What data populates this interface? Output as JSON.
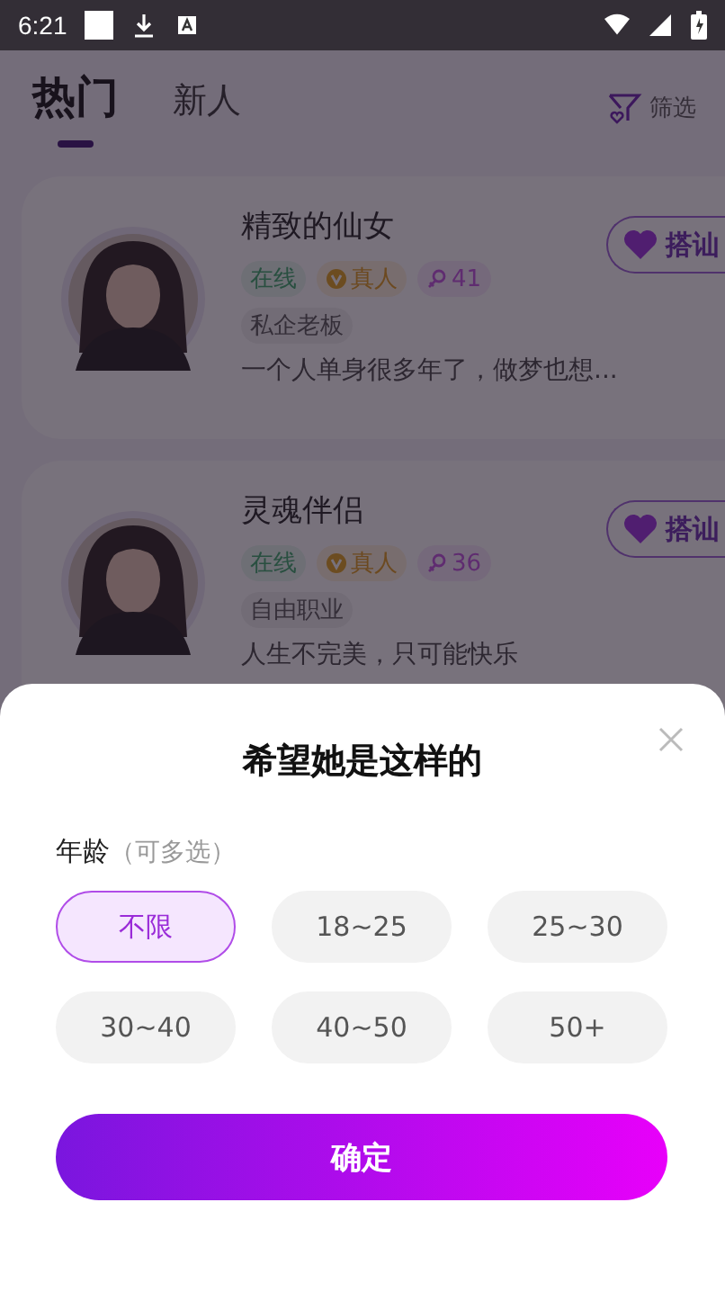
{
  "status_bar": {
    "time": "6:21"
  },
  "tabs": [
    {
      "label": "热门",
      "selected": true
    },
    {
      "label": "新人",
      "selected": false
    }
  ],
  "filter_label": "筛选",
  "cards": [
    {
      "name": "精致的仙女",
      "online": "在线",
      "verified": "真人",
      "age": "41",
      "job": "私企老板",
      "bio": "一个人单身很多年了，做梦也想...",
      "action": "搭讪"
    },
    {
      "name": "灵魂伴侣",
      "online": "在线",
      "verified": "真人",
      "age": "36",
      "job": "自由职业",
      "bio": "人生不完美，只可能快乐",
      "action": "搭讪"
    }
  ],
  "sheet": {
    "title": "希望她是这样的",
    "section_label": "年龄",
    "section_hint": "（可多选）",
    "options": [
      {
        "label": "不限",
        "selected": true
      },
      {
        "label": "18~25",
        "selected": false
      },
      {
        "label": "25~30",
        "selected": false
      },
      {
        "label": "30~40",
        "selected": false
      },
      {
        "label": "40~50",
        "selected": false
      },
      {
        "label": "50+",
        "selected": false
      }
    ],
    "confirm": "确定"
  }
}
